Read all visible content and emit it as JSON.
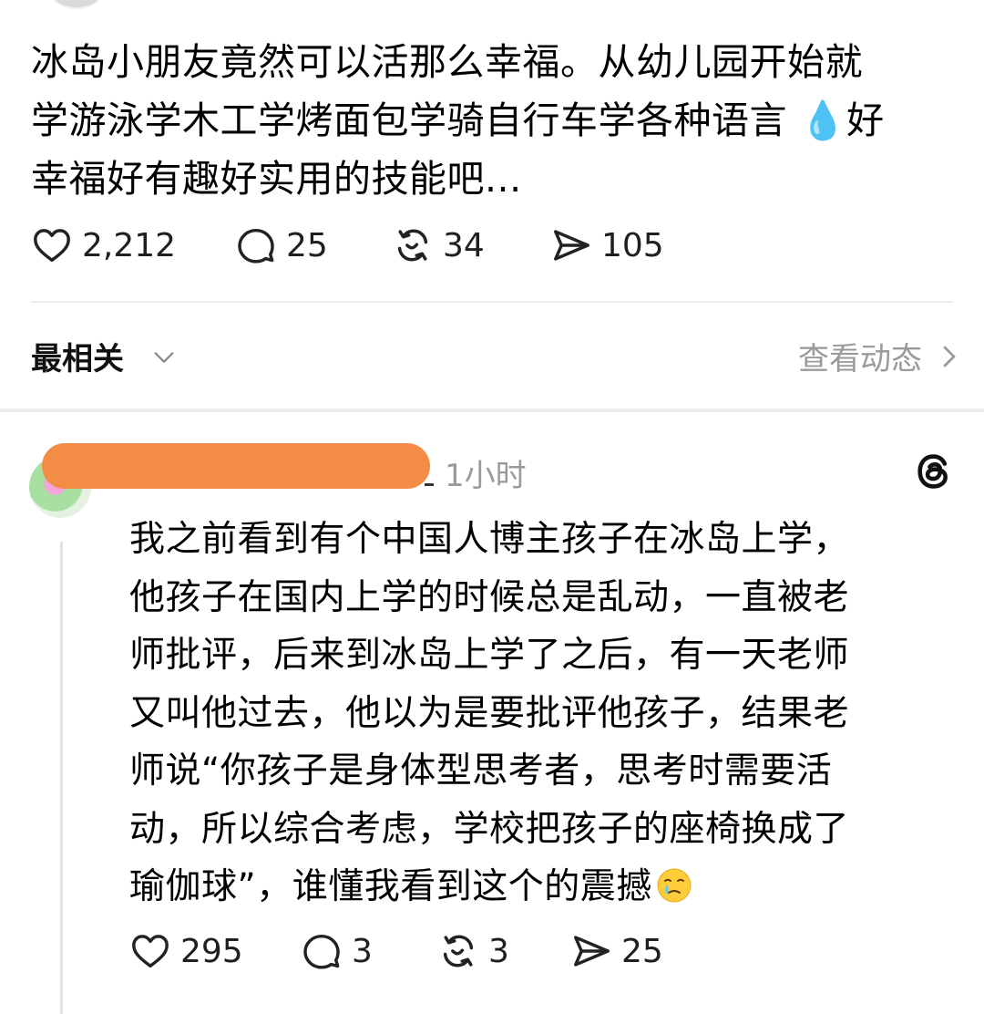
{
  "post": {
    "lines": [
      "冰岛小朋友竟然可以活那么幸福。从幼儿园开始就",
      "学游泳学木工学烤面包学骑自行车学各种语言",
      "幸福好有趣好实用的技能吧..."
    ],
    "drop_emoji": "💧",
    "line2_tail": "好",
    "likes": "2,212",
    "replies": "25",
    "reposts": "34",
    "shares": "105"
  },
  "sort": {
    "label": "最相关",
    "activity_label": "查看动态"
  },
  "reply": {
    "time": "1小时",
    "lines": [
      "我之前看到有个中国人博主孩子在冰岛上学，",
      "他孩子在国内上学的时候总是乱动，一直被老",
      "师批评，后来到冰岛上学了之后，有一天老师",
      "又叫他过去，他以为是要批评他孩子，结果老",
      "师说“你孩子是身体型思考者，思考时需要活",
      "动，所以综合考虑，学校把孩子的座椅换成了",
      "瑜伽球”，谁懂我看到这个的震撼"
    ],
    "likes": "295",
    "replies": "3",
    "reposts": "3",
    "shares": "25"
  },
  "icons": {
    "like": "heart-icon",
    "reply": "speech-bubble-icon",
    "repost": "repost-icon",
    "share": "send-icon",
    "threads": "threads-logo-icon",
    "emoji": "face-holding-back-tears-emoji"
  },
  "colors": {
    "text": "#000000",
    "muted": "#9a9a9a",
    "redaction": "#f38d46",
    "divider": "#ececec"
  }
}
